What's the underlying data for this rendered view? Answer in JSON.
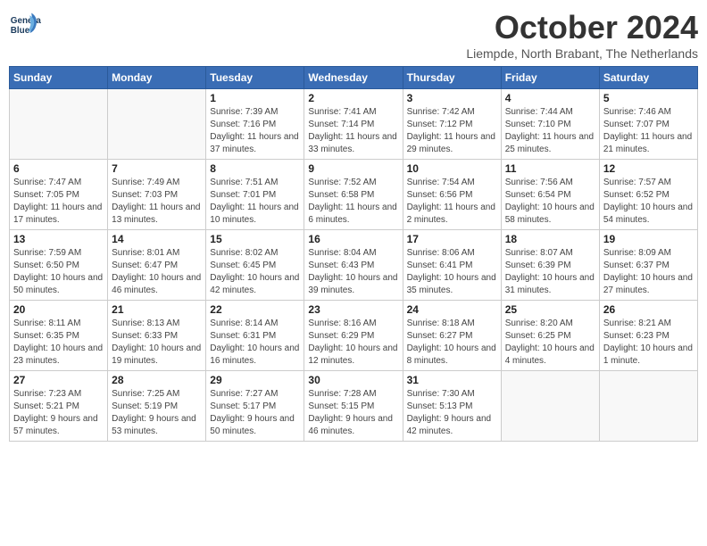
{
  "header": {
    "logo_line1": "General",
    "logo_line2": "Blue",
    "month": "October 2024",
    "location": "Liempde, North Brabant, The Netherlands"
  },
  "days_of_week": [
    "Sunday",
    "Monday",
    "Tuesday",
    "Wednesday",
    "Thursday",
    "Friday",
    "Saturday"
  ],
  "weeks": [
    [
      {
        "day": "",
        "sunrise": "",
        "sunset": "",
        "daylight": ""
      },
      {
        "day": "",
        "sunrise": "",
        "sunset": "",
        "daylight": ""
      },
      {
        "day": "1",
        "sunrise": "Sunrise: 7:39 AM",
        "sunset": "Sunset: 7:16 PM",
        "daylight": "Daylight: 11 hours and 37 minutes."
      },
      {
        "day": "2",
        "sunrise": "Sunrise: 7:41 AM",
        "sunset": "Sunset: 7:14 PM",
        "daylight": "Daylight: 11 hours and 33 minutes."
      },
      {
        "day": "3",
        "sunrise": "Sunrise: 7:42 AM",
        "sunset": "Sunset: 7:12 PM",
        "daylight": "Daylight: 11 hours and 29 minutes."
      },
      {
        "day": "4",
        "sunrise": "Sunrise: 7:44 AM",
        "sunset": "Sunset: 7:10 PM",
        "daylight": "Daylight: 11 hours and 25 minutes."
      },
      {
        "day": "5",
        "sunrise": "Sunrise: 7:46 AM",
        "sunset": "Sunset: 7:07 PM",
        "daylight": "Daylight: 11 hours and 21 minutes."
      }
    ],
    [
      {
        "day": "6",
        "sunrise": "Sunrise: 7:47 AM",
        "sunset": "Sunset: 7:05 PM",
        "daylight": "Daylight: 11 hours and 17 minutes."
      },
      {
        "day": "7",
        "sunrise": "Sunrise: 7:49 AM",
        "sunset": "Sunset: 7:03 PM",
        "daylight": "Daylight: 11 hours and 13 minutes."
      },
      {
        "day": "8",
        "sunrise": "Sunrise: 7:51 AM",
        "sunset": "Sunset: 7:01 PM",
        "daylight": "Daylight: 11 hours and 10 minutes."
      },
      {
        "day": "9",
        "sunrise": "Sunrise: 7:52 AM",
        "sunset": "Sunset: 6:58 PM",
        "daylight": "Daylight: 11 hours and 6 minutes."
      },
      {
        "day": "10",
        "sunrise": "Sunrise: 7:54 AM",
        "sunset": "Sunset: 6:56 PM",
        "daylight": "Daylight: 11 hours and 2 minutes."
      },
      {
        "day": "11",
        "sunrise": "Sunrise: 7:56 AM",
        "sunset": "Sunset: 6:54 PM",
        "daylight": "Daylight: 10 hours and 58 minutes."
      },
      {
        "day": "12",
        "sunrise": "Sunrise: 7:57 AM",
        "sunset": "Sunset: 6:52 PM",
        "daylight": "Daylight: 10 hours and 54 minutes."
      }
    ],
    [
      {
        "day": "13",
        "sunrise": "Sunrise: 7:59 AM",
        "sunset": "Sunset: 6:50 PM",
        "daylight": "Daylight: 10 hours and 50 minutes."
      },
      {
        "day": "14",
        "sunrise": "Sunrise: 8:01 AM",
        "sunset": "Sunset: 6:47 PM",
        "daylight": "Daylight: 10 hours and 46 minutes."
      },
      {
        "day": "15",
        "sunrise": "Sunrise: 8:02 AM",
        "sunset": "Sunset: 6:45 PM",
        "daylight": "Daylight: 10 hours and 42 minutes."
      },
      {
        "day": "16",
        "sunrise": "Sunrise: 8:04 AM",
        "sunset": "Sunset: 6:43 PM",
        "daylight": "Daylight: 10 hours and 39 minutes."
      },
      {
        "day": "17",
        "sunrise": "Sunrise: 8:06 AM",
        "sunset": "Sunset: 6:41 PM",
        "daylight": "Daylight: 10 hours and 35 minutes."
      },
      {
        "day": "18",
        "sunrise": "Sunrise: 8:07 AM",
        "sunset": "Sunset: 6:39 PM",
        "daylight": "Daylight: 10 hours and 31 minutes."
      },
      {
        "day": "19",
        "sunrise": "Sunrise: 8:09 AM",
        "sunset": "Sunset: 6:37 PM",
        "daylight": "Daylight: 10 hours and 27 minutes."
      }
    ],
    [
      {
        "day": "20",
        "sunrise": "Sunrise: 8:11 AM",
        "sunset": "Sunset: 6:35 PM",
        "daylight": "Daylight: 10 hours and 23 minutes."
      },
      {
        "day": "21",
        "sunrise": "Sunrise: 8:13 AM",
        "sunset": "Sunset: 6:33 PM",
        "daylight": "Daylight: 10 hours and 19 minutes."
      },
      {
        "day": "22",
        "sunrise": "Sunrise: 8:14 AM",
        "sunset": "Sunset: 6:31 PM",
        "daylight": "Daylight: 10 hours and 16 minutes."
      },
      {
        "day": "23",
        "sunrise": "Sunrise: 8:16 AM",
        "sunset": "Sunset: 6:29 PM",
        "daylight": "Daylight: 10 hours and 12 minutes."
      },
      {
        "day": "24",
        "sunrise": "Sunrise: 8:18 AM",
        "sunset": "Sunset: 6:27 PM",
        "daylight": "Daylight: 10 hours and 8 minutes."
      },
      {
        "day": "25",
        "sunrise": "Sunrise: 8:20 AM",
        "sunset": "Sunset: 6:25 PM",
        "daylight": "Daylight: 10 hours and 4 minutes."
      },
      {
        "day": "26",
        "sunrise": "Sunrise: 8:21 AM",
        "sunset": "Sunset: 6:23 PM",
        "daylight": "Daylight: 10 hours and 1 minute."
      }
    ],
    [
      {
        "day": "27",
        "sunrise": "Sunrise: 7:23 AM",
        "sunset": "Sunset: 5:21 PM",
        "daylight": "Daylight: 9 hours and 57 minutes."
      },
      {
        "day": "28",
        "sunrise": "Sunrise: 7:25 AM",
        "sunset": "Sunset: 5:19 PM",
        "daylight": "Daylight: 9 hours and 53 minutes."
      },
      {
        "day": "29",
        "sunrise": "Sunrise: 7:27 AM",
        "sunset": "Sunset: 5:17 PM",
        "daylight": "Daylight: 9 hours and 50 minutes."
      },
      {
        "day": "30",
        "sunrise": "Sunrise: 7:28 AM",
        "sunset": "Sunset: 5:15 PM",
        "daylight": "Daylight: 9 hours and 46 minutes."
      },
      {
        "day": "31",
        "sunrise": "Sunrise: 7:30 AM",
        "sunset": "Sunset: 5:13 PM",
        "daylight": "Daylight: 9 hours and 42 minutes."
      },
      {
        "day": "",
        "sunrise": "",
        "sunset": "",
        "daylight": ""
      },
      {
        "day": "",
        "sunrise": "",
        "sunset": "",
        "daylight": ""
      }
    ]
  ]
}
